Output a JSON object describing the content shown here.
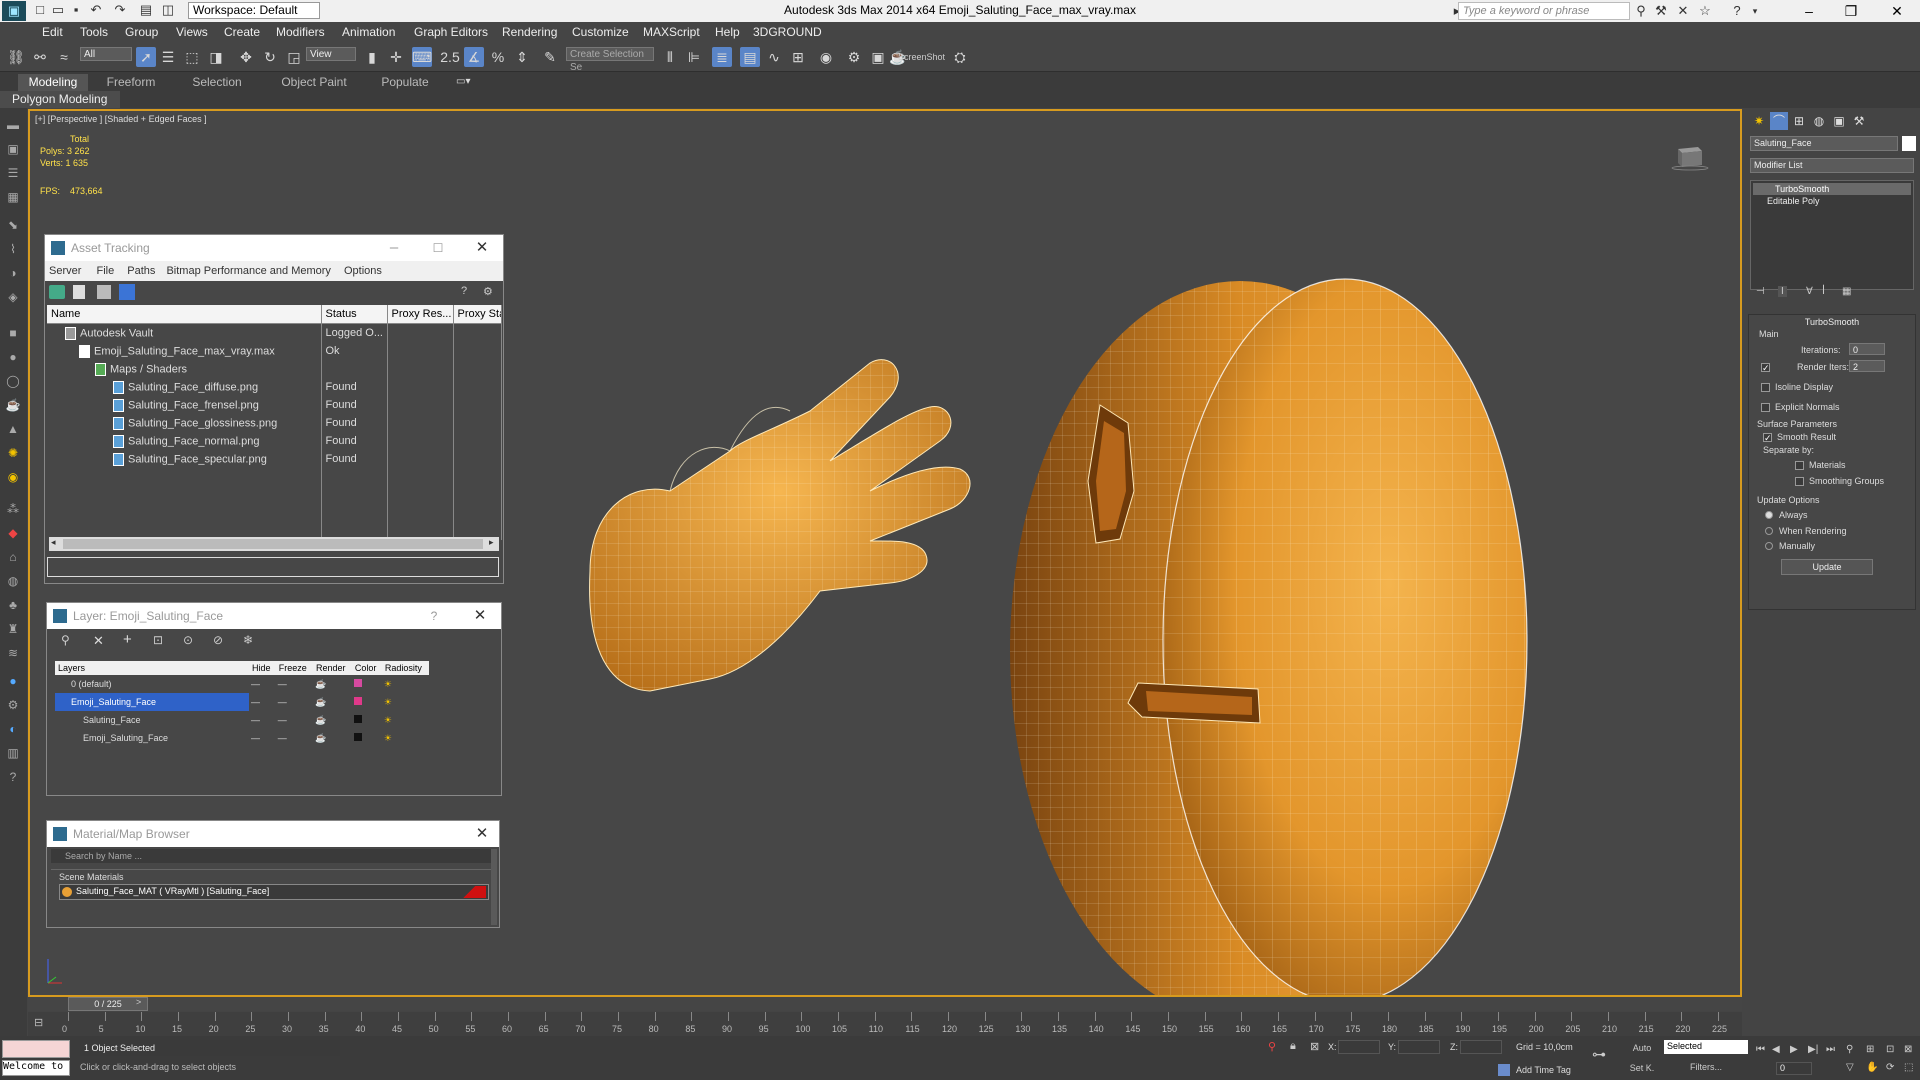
{
  "titlebar": {
    "workspace": "Workspace: Default",
    "title": "Autodesk 3ds Max  2014 x64      Emoji_Saluting_Face_max_vray.max",
    "search_placeholder": "Type a keyword or phrase"
  },
  "menu": [
    "Edit",
    "Tools",
    "Group",
    "Views",
    "Create",
    "Modifiers",
    "Animation",
    "Graph Editors",
    "Rendering",
    "Customize",
    "MAXScript",
    "Help",
    "3DGROUND"
  ],
  "toolbar": {
    "filter_value": "All",
    "refcoord_value": "View",
    "selset_placeholder": "Create Selection Se",
    "screenshot_label": "ScreenShot"
  },
  "ribbon": {
    "tabs": [
      "Modeling",
      "Freeform",
      "Selection",
      "Object Paint",
      "Populate"
    ],
    "polygon_modeling": "Polygon Modeling"
  },
  "viewport": {
    "label": "[+] [Perspective ] [Shaded + Edged Faces ]",
    "stats_total": "Total",
    "polys_label": "Polys:",
    "polys_value": "3 262",
    "verts_label": "Verts:",
    "verts_value": "1 635",
    "fps_label": "FPS:",
    "fps_value": "473,664"
  },
  "asset_tracking": {
    "title": "Asset Tracking",
    "menu": [
      "Server",
      "File",
      "Paths",
      "Bitmap Performance and Memory",
      "Options"
    ],
    "columns": [
      "Name",
      "Status",
      "Proxy Res...",
      "Proxy Sta"
    ],
    "rows": [
      {
        "name": "Autodesk Vault",
        "status": "Logged O..."
      },
      {
        "name": "Emoji_Saluting_Face_max_vray.max",
        "status": "Ok"
      },
      {
        "name": "Maps / Shaders",
        "status": ""
      },
      {
        "name": "Saluting_Face_diffuse.png",
        "status": "Found"
      },
      {
        "name": "Saluting_Face_frensel.png",
        "status": "Found"
      },
      {
        "name": "Saluting_Face_glossiness.png",
        "status": "Found"
      },
      {
        "name": "Saluting_Face_normal.png",
        "status": "Found"
      },
      {
        "name": "Saluting_Face_specular.png",
        "status": "Found"
      }
    ]
  },
  "layer": {
    "title": "Layer: Emoji_Saluting_Face",
    "columns": [
      "Layers",
      "Hide",
      "Freeze",
      "Render",
      "Color",
      "Radiosity"
    ],
    "rows": [
      {
        "name": "0 (default)"
      },
      {
        "name": "Emoji_Saluting_Face"
      },
      {
        "name": "Saluting_Face"
      },
      {
        "name": "Emoji_Saluting_Face"
      }
    ]
  },
  "material_browser": {
    "title": "Material/Map Browser",
    "search_placeholder": "Search by Name ...",
    "section": "Scene Materials",
    "item": "Saluting_Face_MAT ( VRayMtl ) [Saluting_Face]"
  },
  "command_panel": {
    "object_name": "Saluting_Face",
    "modifier_list": "Modifier List",
    "stack": [
      "TurboSmooth",
      "Editable Poly"
    ],
    "turbosmooth_title": "TurboSmooth",
    "main_label": "Main",
    "iterations_label": "Iterations:",
    "iterations_value": "0",
    "render_iters_label": "Render Iters:",
    "render_iters_value": "2",
    "isoline_label": "Isoline Display",
    "explicit_label": "Explicit Normals",
    "surface_label": "Surface Parameters",
    "smooth_label": "Smooth Result",
    "separate_label": "Separate by:",
    "materials_label": "Materials",
    "smoothing_label": "Smoothing Groups",
    "update_options_label": "Update Options",
    "always_label": "Always",
    "when_rendering_label": "When Rendering",
    "manually_label": "Manually",
    "update_button": "Update"
  },
  "timeline": {
    "frame_counter": "0 / 225",
    "ticks": [
      "0",
      "5",
      "10",
      "15",
      "20",
      "25",
      "30",
      "35",
      "40",
      "45",
      "50",
      "55",
      "60",
      "65",
      "70",
      "75",
      "80",
      "85",
      "90",
      "95",
      "100",
      "105",
      "110",
      "115",
      "120",
      "125",
      "130",
      "135",
      "140",
      "145",
      "150",
      "155",
      "160",
      "165",
      "170",
      "175",
      "180",
      "185",
      "190",
      "195",
      "200",
      "205",
      "210",
      "215",
      "220",
      "225"
    ]
  },
  "status": {
    "welcome": "Welcome to",
    "selected": "1 Object Selected",
    "hint": "Click or click-and-drag to select objects",
    "x_label": "X:",
    "y_label": "Y:",
    "z_label": "Z:",
    "grid": "Grid = 10,0cm",
    "add_time_tag": "Add Time Tag",
    "auto": "Auto",
    "selected_dropdown": "Selected",
    "set_k": "Set K.",
    "filters": "Filters...",
    "frame_value": "0"
  },
  "colors": {
    "accent": "#d79b1f",
    "selection": "#2f62c8",
    "viewport_bg": "#474747",
    "emoji_orange": "#e8a035"
  }
}
